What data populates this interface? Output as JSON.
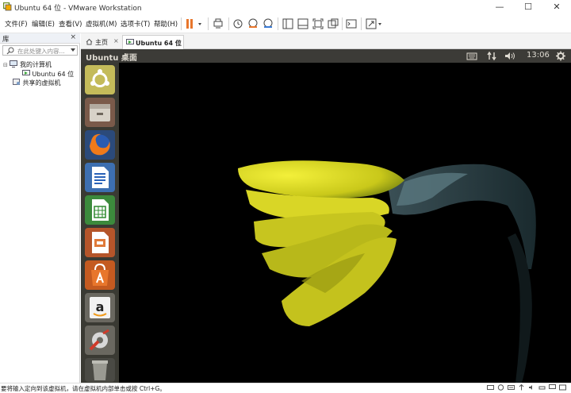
{
  "window": {
    "title": "Ubuntu 64 位 - VMware Workstation",
    "minimize": "—",
    "maximize": "☐",
    "close": "✕"
  },
  "menu": {
    "file": "文件(F)",
    "edit": "编辑(E)",
    "view": "查看(V)",
    "vm": "虚拟机(M)",
    "tabs": "选项卡(T)",
    "help": "帮助(H)"
  },
  "toolbar": {
    "icons": [
      "pause-icon",
      "send-ctrl-alt-del-icon",
      "snapshot-icon",
      "revert-snapshot-icon",
      "snapshot-manager-icon",
      "show-library-icon",
      "thumbnail-icon",
      "fullscreen-icon",
      "unity-icon",
      "console-icon",
      "stretch-icon"
    ]
  },
  "library": {
    "title": "库",
    "close": "×",
    "search_placeholder": "在此处键入内容...",
    "tree": {
      "my_computer": "我的计算机",
      "vm": "Ubuntu 64 位",
      "shared": "共享的虚拟机"
    }
  },
  "tabs": [
    {
      "label": "主页",
      "close": "×"
    },
    {
      "label": "Ubuntu 64 位",
      "close": "×"
    }
  ],
  "ubuntu": {
    "title": "Ubuntu 桌面",
    "clock": "13:06",
    "launcher": [
      "ubuntu-dash-icon",
      "files-icon",
      "firefox-icon",
      "writer-icon",
      "calc-icon",
      "impress-icon",
      "software-center-icon",
      "amazon-icon",
      "system-settings-icon",
      "trash-icon"
    ]
  },
  "status": {
    "message": "要将输入定向到该虚拟机，请在虚拟机内部单击或按 Ctrl+G。"
  },
  "colors": {
    "ubuntu_panel": "#3c3b37",
    "launcher_bg": "#3a3a33",
    "pause_orange": "#e8762c"
  }
}
